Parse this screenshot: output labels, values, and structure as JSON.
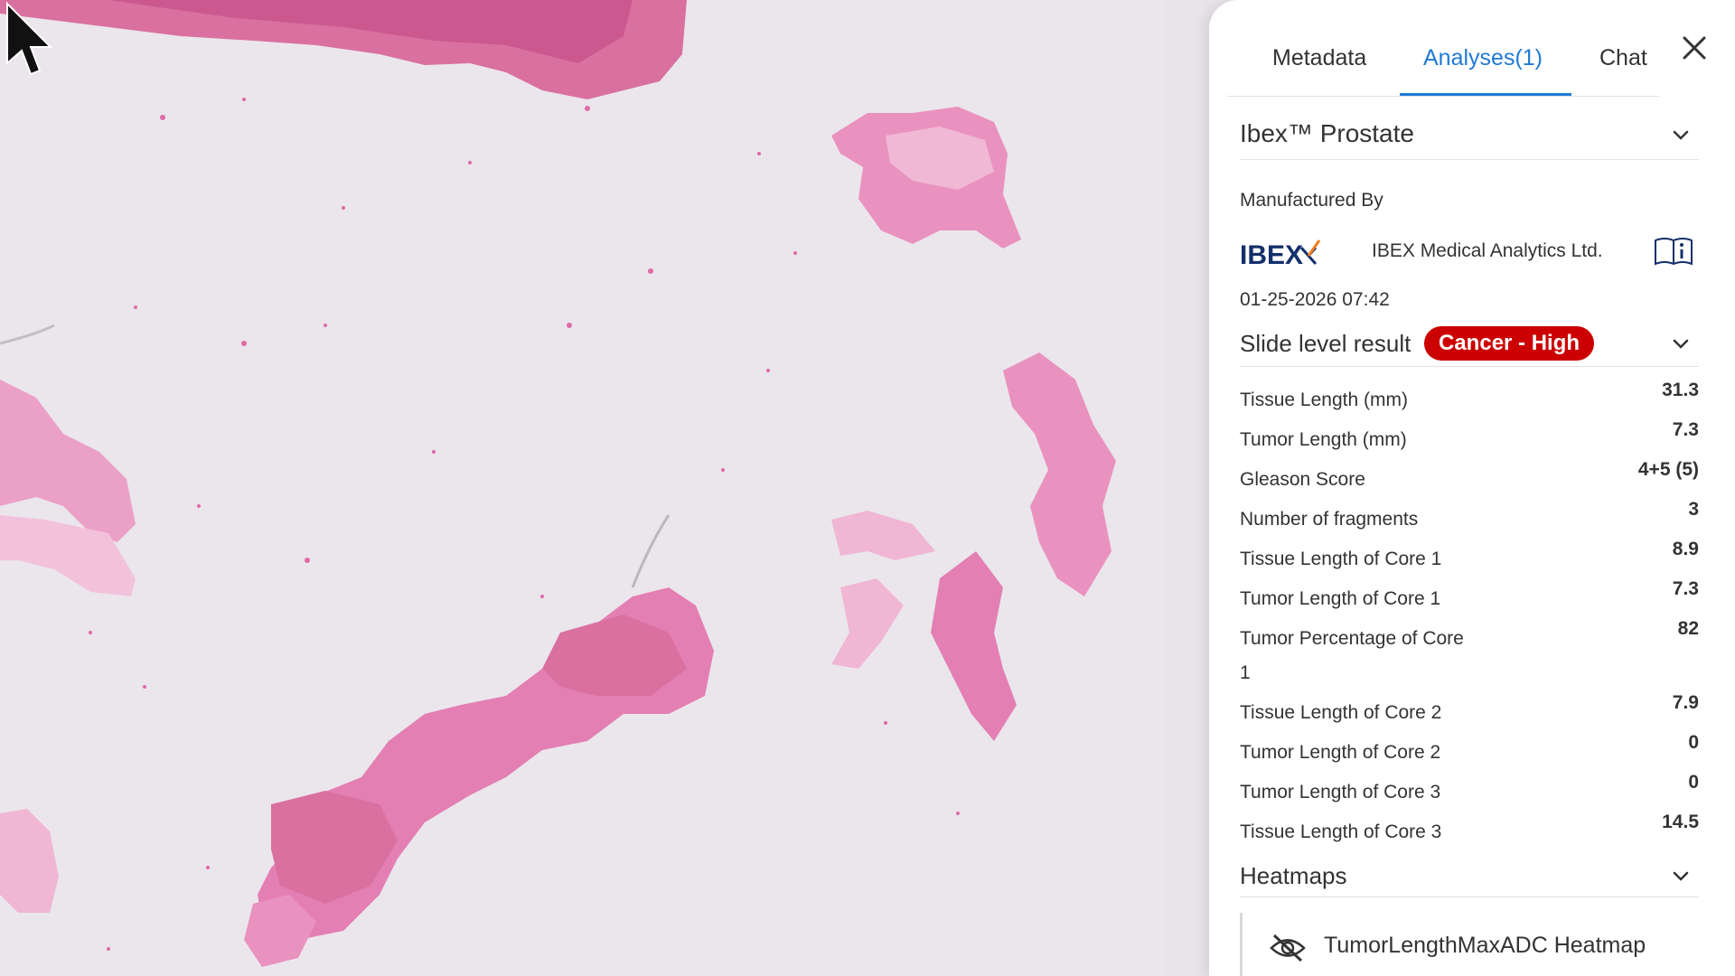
{
  "tabs": [
    {
      "label": "Metadata"
    },
    {
      "label": "Analyses"
    },
    {
      "label": "Chat"
    }
  ],
  "analyses_count": "(1)",
  "product": {
    "name": "Ibex™ Prostate"
  },
  "manufacturer": {
    "heading": "Manufactured By",
    "logo_text": "IBEX",
    "company": "IBEX Medical Analytics Ltd."
  },
  "timestamp": "01-25-2026 07:42",
  "slide_result": {
    "label": "Slide level result",
    "badge": "Cancer - High",
    "badge_color": "#cc0000"
  },
  "metrics": [
    {
      "label": "Tissue Length (mm)",
      "value": "31.3"
    },
    {
      "label": "Tumor Length (mm)",
      "value": "7.3"
    },
    {
      "label": "Gleason Score",
      "value": "4+5 (5)"
    },
    {
      "label": "Number of fragments",
      "value": "3"
    },
    {
      "label": "Tissue Length of Core 1",
      "value": "8.9"
    },
    {
      "label": "Tumor Length of Core 1",
      "value": "7.3"
    },
    {
      "label": "Tumor Percentage of Core 1",
      "value": "82"
    },
    {
      "label": "Tissue Length of Core 2",
      "value": "7.9"
    },
    {
      "label": "Tumor Length of Core 2",
      "value": "0"
    },
    {
      "label": "Tumor Length of Core 3",
      "value": "0"
    },
    {
      "label": "Tissue Length of Core 3",
      "value": "14.5"
    }
  ],
  "heatmaps": {
    "title": "Heatmaps",
    "items": [
      {
        "name": "TumorLengthMaxADC Heatmap",
        "icon": "eye-off-icon"
      }
    ]
  },
  "colors": {
    "accent": "#1f7ad6",
    "tissue": "#e58ab8",
    "logo_orange": "#f07d1a",
    "logo_navy": "#14306b"
  }
}
